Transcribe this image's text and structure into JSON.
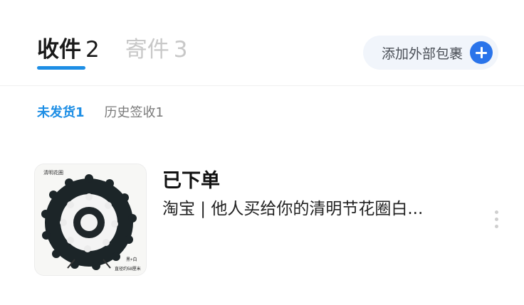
{
  "tabs": [
    {
      "label": "收件",
      "count": "2"
    },
    {
      "label": "寄件",
      "count": "3"
    }
  ],
  "add_button": {
    "label": "添加外部包裹",
    "icon": "plus-circle-icon"
  },
  "sub_tabs": [
    {
      "label": "未发货1"
    },
    {
      "label": "历史签收1"
    }
  ],
  "order": {
    "status": "已下单",
    "description": "淘宝 | 他人买给你的清明节花圈白...",
    "thumbnail": {
      "top_label": "清明花圈",
      "corner_label_1": "黑+白",
      "corner_label_2": "直径约58厘米"
    }
  },
  "colors": {
    "accent": "#1d8ee5",
    "button_bg": "#f1f5fb",
    "plus_icon": "#2a74ea"
  }
}
